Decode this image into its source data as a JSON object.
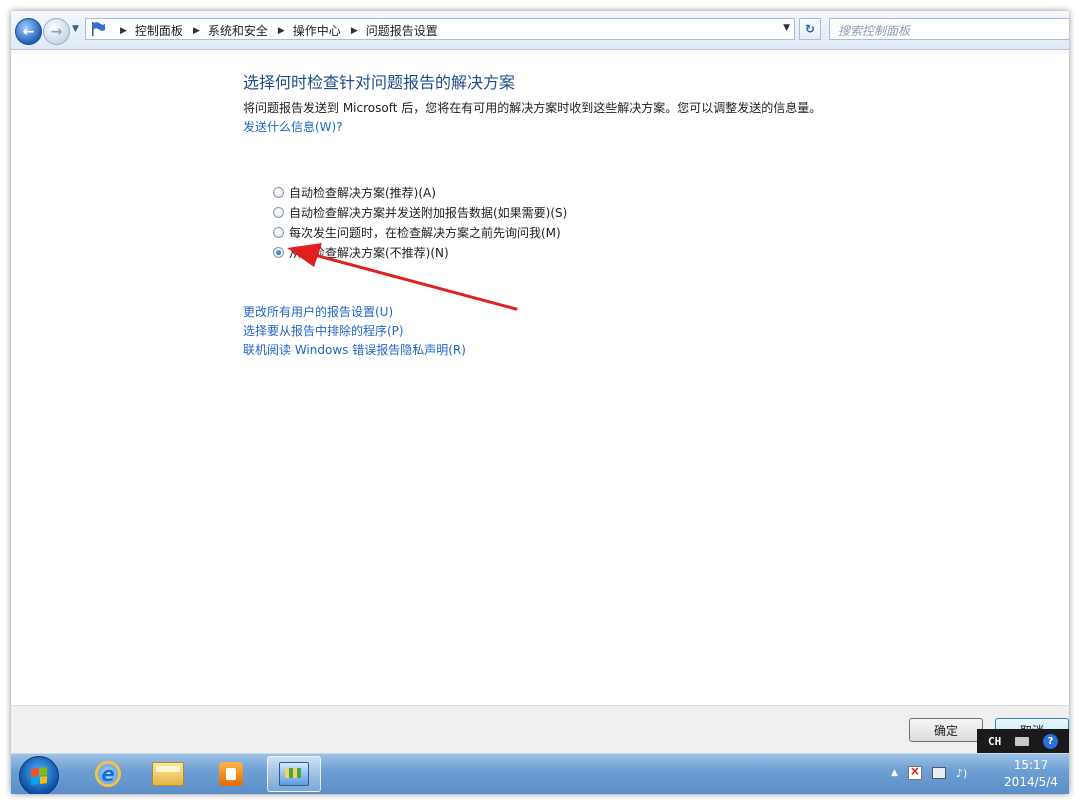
{
  "address_bar": {
    "breadcrumbs": [
      "控制面板",
      "系统和安全",
      "操作中心",
      "问题报告设置"
    ],
    "search_placeholder": "搜索控制面板"
  },
  "main": {
    "title": "选择何时检查针对问题报告的解决方案",
    "description": "将问题报告发送到 Microsoft 后，您将在有可用的解决方案时收到这些解决方案。您可以调整发送的信息量。",
    "send_info_link": "发送什么信息(W)?",
    "options": [
      {
        "label": "自动检查解决方案(推荐)(A)",
        "checked": false
      },
      {
        "label": "自动检查解决方案并发送附加报告数据(如果需要)(S)",
        "checked": false
      },
      {
        "label": "每次发生问题时，在检查解决方案之前先询问我(M)",
        "checked": false
      },
      {
        "label": "从不检查解决方案(不推荐)(N)",
        "checked": true
      }
    ],
    "links": [
      "更改所有用户的报告设置(U)",
      "选择要从报告中排除的程序(P)",
      "联机阅读 Windows 错误报告隐私声明(R)"
    ]
  },
  "buttons": {
    "ok": "确定",
    "cancel": "取消"
  },
  "ime": {
    "label": "CH"
  },
  "taskbar": {
    "clock_time": "15:17",
    "clock_date": "2014/5/4"
  },
  "annotation": {
    "arrow_color": "#e02020"
  }
}
